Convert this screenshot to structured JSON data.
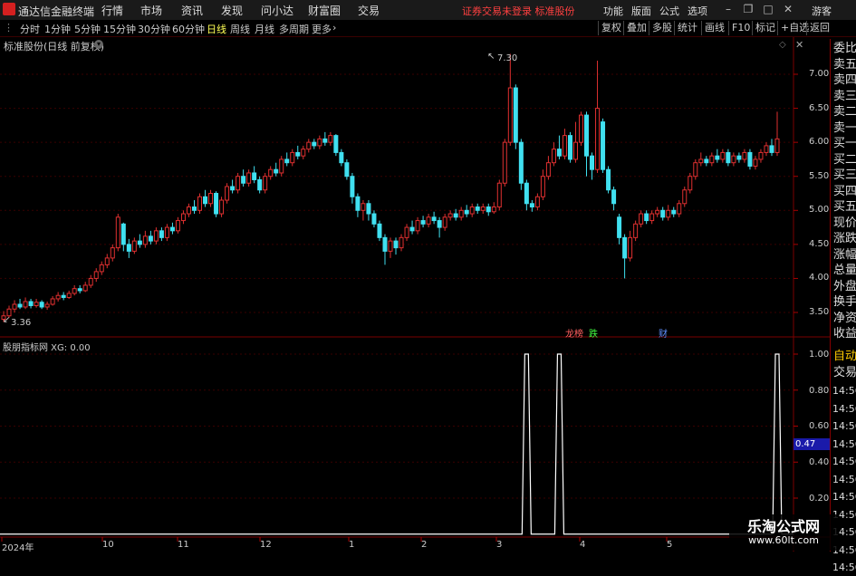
{
  "titlebar": {
    "app_title": "通达信金融终端",
    "menus": [
      "行情",
      "市场",
      "资讯",
      "发现",
      "问小达",
      "财富圈",
      "交易"
    ],
    "notice": "证券交易未登录  标准股份",
    "right_menus": [
      "功能",
      "版面",
      "公式",
      "选项"
    ],
    "user": "游客"
  },
  "toolbar": {
    "periods": [
      "分时",
      "1分钟",
      "5分钟",
      "15分钟",
      "30分钟",
      "60分钟",
      "日线",
      "周线",
      "月线",
      "多周期",
      "更多"
    ],
    "active_period": "日线",
    "right_tools": [
      "复权",
      "叠加",
      "多股",
      "统计",
      "画线",
      "F10",
      "标记",
      "+自选",
      "返回"
    ]
  },
  "main_chart": {
    "header": "标准股份(日线 前复权)",
    "y_ticks": [
      "7.00",
      "6.50",
      "6.00",
      "5.50",
      "5.00",
      "4.50",
      "4.00",
      "3.50"
    ],
    "high_label": "7.30",
    "low_label": "3.36",
    "event_markers": [
      {
        "text": "龙榜",
        "color": "#ff6060"
      },
      {
        "text": "跌",
        "color": "#40ff40"
      },
      {
        "text": "财",
        "color": "#6090ff"
      }
    ]
  },
  "indicator": {
    "header": "股朋指标网 XG: 0.00",
    "y_ticks": [
      "1.00",
      "0.80",
      "0.60",
      "0.40",
      "0.20"
    ],
    "cursor_value": "0.47"
  },
  "x_axis": [
    "2024年",
    "10",
    "11",
    "12",
    "1",
    "2",
    "3",
    "4",
    "5"
  ],
  "side_panel": {
    "labels": [
      "委比",
      "卖五",
      "卖四",
      "卖三",
      "卖二",
      "卖一",
      "买一",
      "买二",
      "买三",
      "买四",
      "买五",
      "现价",
      "涨跌",
      "涨幅",
      "总量",
      "外盘",
      "换手",
      "净资",
      "收益"
    ],
    "tabs": [
      "自动",
      "交易"
    ],
    "clock": [
      "14:56",
      "14:56",
      "14:56",
      "14:56",
      "14:56",
      "14:56",
      "14:56",
      "14:56",
      "14:56",
      "14:56",
      "14:56"
    ]
  },
  "watermark": {
    "line1": "乐淘公式网",
    "line2": "www.60lt.com"
  },
  "colors": {
    "up": "#e03030",
    "down": "#40e0f0",
    "grid": "#7a0000",
    "bg": "#000000"
  },
  "chart_data": {
    "type": "candlestick",
    "y_range": [
      3.3,
      7.5
    ],
    "candles": [
      [
        3.4,
        3.45,
        3.52,
        3.36
      ],
      [
        3.45,
        3.55,
        3.6,
        3.42
      ],
      [
        3.55,
        3.62,
        3.68,
        3.5
      ],
      [
        3.62,
        3.58,
        3.7,
        3.55
      ],
      [
        3.58,
        3.66,
        3.72,
        3.55
      ],
      [
        3.66,
        3.6,
        3.7,
        3.56
      ],
      [
        3.6,
        3.65,
        3.7,
        3.57
      ],
      [
        3.65,
        3.58,
        3.68,
        3.55
      ],
      [
        3.58,
        3.62,
        3.66,
        3.54
      ],
      [
        3.62,
        3.7,
        3.74,
        3.6
      ],
      [
        3.7,
        3.75,
        3.8,
        3.66
      ],
      [
        3.75,
        3.72,
        3.8,
        3.68
      ],
      [
        3.72,
        3.78,
        3.82,
        3.7
      ],
      [
        3.78,
        3.85,
        3.9,
        3.75
      ],
      [
        3.85,
        3.82,
        3.9,
        3.78
      ],
      [
        3.82,
        3.9,
        3.95,
        3.8
      ],
      [
        3.9,
        4.0,
        4.05,
        3.86
      ],
      [
        4.0,
        4.1,
        4.15,
        3.95
      ],
      [
        4.1,
        4.2,
        4.25,
        4.05
      ],
      [
        4.2,
        4.3,
        4.36,
        4.15
      ],
      [
        4.3,
        4.45,
        4.5,
        4.25
      ],
      [
        4.45,
        4.9,
        4.95,
        4.4
      ],
      [
        4.8,
        4.5,
        4.82,
        4.4
      ],
      [
        4.5,
        4.4,
        4.58,
        4.3
      ],
      [
        4.4,
        4.55,
        4.6,
        4.36
      ],
      [
        4.55,
        4.5,
        4.65,
        4.45
      ],
      [
        4.5,
        4.62,
        4.7,
        4.45
      ],
      [
        4.62,
        4.55,
        4.7,
        4.5
      ],
      [
        4.55,
        4.7,
        4.75,
        4.5
      ],
      [
        4.7,
        4.6,
        4.75,
        4.55
      ],
      [
        4.6,
        4.75,
        4.8,
        4.55
      ],
      [
        4.75,
        4.7,
        4.82,
        4.65
      ],
      [
        4.7,
        4.85,
        4.9,
        4.66
      ],
      [
        4.85,
        4.95,
        5.0,
        4.8
      ],
      [
        4.95,
        5.05,
        5.1,
        4.9
      ],
      [
        5.05,
        5.0,
        5.15,
        4.95
      ],
      [
        5.0,
        5.2,
        5.25,
        4.95
      ],
      [
        5.2,
        5.1,
        5.3,
        5.05
      ],
      [
        5.1,
        5.25,
        5.3,
        5.05
      ],
      [
        5.25,
        4.95,
        5.28,
        4.9
      ],
      [
        4.95,
        5.15,
        5.2,
        4.9
      ],
      [
        5.15,
        5.35,
        5.4,
        5.1
      ],
      [
        5.35,
        5.3,
        5.45,
        5.25
      ],
      [
        5.3,
        5.5,
        5.55,
        5.25
      ],
      [
        5.5,
        5.4,
        5.6,
        5.35
      ],
      [
        5.4,
        5.55,
        5.6,
        5.35
      ],
      [
        5.55,
        5.45,
        5.65,
        5.4
      ],
      [
        5.45,
        5.3,
        5.5,
        5.25
      ],
      [
        5.3,
        5.5,
        5.55,
        5.25
      ],
      [
        5.5,
        5.6,
        5.65,
        5.45
      ],
      [
        5.6,
        5.55,
        5.7,
        5.5
      ],
      [
        5.55,
        5.75,
        5.8,
        5.5
      ],
      [
        5.75,
        5.7,
        5.85,
        5.65
      ],
      [
        5.7,
        5.85,
        5.9,
        5.65
      ],
      [
        5.85,
        5.8,
        5.95,
        5.75
      ],
      [
        5.8,
        5.9,
        5.95,
        5.75
      ],
      [
        5.9,
        6.0,
        6.05,
        5.85
      ],
      [
        6.0,
        5.95,
        6.05,
        5.9
      ],
      [
        5.95,
        6.05,
        6.1,
        5.9
      ],
      [
        6.05,
        6.0,
        6.15,
        5.95
      ],
      [
        6.0,
        6.1,
        6.15,
        5.95
      ],
      [
        6.1,
        5.85,
        6.12,
        5.8
      ],
      [
        5.85,
        5.7,
        5.9,
        5.65
      ],
      [
        5.7,
        5.5,
        5.75,
        5.45
      ],
      [
        5.5,
        5.2,
        5.55,
        5.1
      ],
      [
        5.2,
        5.0,
        5.25,
        4.9
      ],
      [
        5.0,
        5.1,
        5.15,
        4.85
      ],
      [
        5.1,
        4.95,
        5.15,
        4.85
      ],
      [
        4.95,
        4.8,
        5.0,
        4.75
      ],
      [
        4.8,
        4.6,
        4.85,
        4.55
      ],
      [
        4.6,
        4.4,
        4.65,
        4.2
      ],
      [
        4.4,
        4.55,
        4.6,
        4.3
      ],
      [
        4.55,
        4.45,
        4.6,
        4.35
      ],
      [
        4.45,
        4.6,
        4.65,
        4.4
      ],
      [
        4.6,
        4.75,
        4.8,
        4.55
      ],
      [
        4.75,
        4.7,
        4.85,
        4.65
      ],
      [
        4.7,
        4.85,
        4.9,
        4.65
      ],
      [
        4.85,
        4.8,
        4.92,
        4.75
      ],
      [
        4.8,
        4.9,
        4.95,
        4.75
      ],
      [
        4.9,
        4.85,
        4.98,
        4.8
      ],
      [
        4.85,
        4.75,
        4.9,
        4.6
      ],
      [
        4.75,
        4.9,
        4.95,
        4.7
      ],
      [
        4.9,
        4.95,
        5.0,
        4.85
      ],
      [
        4.95,
        4.9,
        5.02,
        4.85
      ],
      [
        4.9,
        5.0,
        5.05,
        4.85
      ],
      [
        5.0,
        4.95,
        5.08,
        4.9
      ],
      [
        4.95,
        5.05,
        5.1,
        4.9
      ],
      [
        5.05,
        5.0,
        5.1,
        4.95
      ],
      [
        5.0,
        5.05,
        5.1,
        4.95
      ],
      [
        5.05,
        4.98,
        5.1,
        4.92
      ],
      [
        4.98,
        5.05,
        5.12,
        4.95
      ],
      [
        5.05,
        5.4,
        5.45,
        5.0
      ],
      [
        5.4,
        6.0,
        6.05,
        5.35
      ],
      [
        6.0,
        6.8,
        7.3,
        5.95
      ],
      [
        6.8,
        6.0,
        6.85,
        5.9
      ],
      [
        6.0,
        5.4,
        6.05,
        5.3
      ],
      [
        5.4,
        5.1,
        5.45,
        5.0
      ],
      [
        5.1,
        5.05,
        5.15,
        4.98
      ],
      [
        5.05,
        5.2,
        5.25,
        5.0
      ],
      [
        5.2,
        5.5,
        5.6,
        5.15
      ],
      [
        5.5,
        5.7,
        5.8,
        5.45
      ],
      [
        5.7,
        5.9,
        6.0,
        5.65
      ],
      [
        5.9,
        5.8,
        6.1,
        5.75
      ],
      [
        5.8,
        6.1,
        6.2,
        5.75
      ],
      [
        6.1,
        5.75,
        6.15,
        5.7
      ],
      [
        5.75,
        6.0,
        6.3,
        5.7
      ],
      [
        6.0,
        6.4,
        6.45,
        5.95
      ],
      [
        6.4,
        5.8,
        6.45,
        5.5
      ],
      [
        5.8,
        5.6,
        5.85,
        5.45
      ],
      [
        5.6,
        6.5,
        7.2,
        5.55
      ],
      [
        6.3,
        5.6,
        6.35,
        5.55
      ],
      [
        5.6,
        5.3,
        5.65,
        5.25
      ],
      [
        5.3,
        5.1,
        5.35,
        5.0
      ],
      [
        4.9,
        4.6,
        4.95,
        4.5
      ],
      [
        4.6,
        4.3,
        4.65,
        4.0
      ],
      [
        4.3,
        4.6,
        4.7,
        4.25
      ],
      [
        4.6,
        4.8,
        4.85,
        4.55
      ],
      [
        4.8,
        4.95,
        5.0,
        4.75
      ],
      [
        4.95,
        4.85,
        5.0,
        4.8
      ],
      [
        4.85,
        4.95,
        5.0,
        4.8
      ],
      [
        4.95,
        5.0,
        5.05,
        4.9
      ],
      [
        5.0,
        4.9,
        5.05,
        4.85
      ],
      [
        4.9,
        5.0,
        5.08,
        4.85
      ],
      [
        5.0,
        4.95,
        5.05,
        4.9
      ],
      [
        4.95,
        5.1,
        5.15,
        4.9
      ],
      [
        5.1,
        5.3,
        5.35,
        5.05
      ],
      [
        5.3,
        5.5,
        5.55,
        5.25
      ],
      [
        5.5,
        5.7,
        5.75,
        5.45
      ],
      [
        5.7,
        5.75,
        5.85,
        5.65
      ],
      [
        5.75,
        5.7,
        5.8,
        5.65
      ],
      [
        5.7,
        5.8,
        5.85,
        5.65
      ],
      [
        5.8,
        5.75,
        5.9,
        5.7
      ],
      [
        5.75,
        5.85,
        5.9,
        5.7
      ],
      [
        5.85,
        5.7,
        5.9,
        5.65
      ],
      [
        5.7,
        5.8,
        5.85,
        5.65
      ],
      [
        5.8,
        5.75,
        5.85,
        5.7
      ],
      [
        5.75,
        5.85,
        5.9,
        5.7
      ],
      [
        5.85,
        5.65,
        5.9,
        5.6
      ],
      [
        5.65,
        5.75,
        5.8,
        5.6
      ],
      [
        5.75,
        5.85,
        5.9,
        5.7
      ],
      [
        5.85,
        5.95,
        6.0,
        5.8
      ],
      [
        5.95,
        5.85,
        6.05,
        5.8
      ],
      [
        5.85,
        6.05,
        6.45,
        5.8
      ]
    ],
    "xg_signal_indices": [
      96,
      102,
      142
    ]
  }
}
